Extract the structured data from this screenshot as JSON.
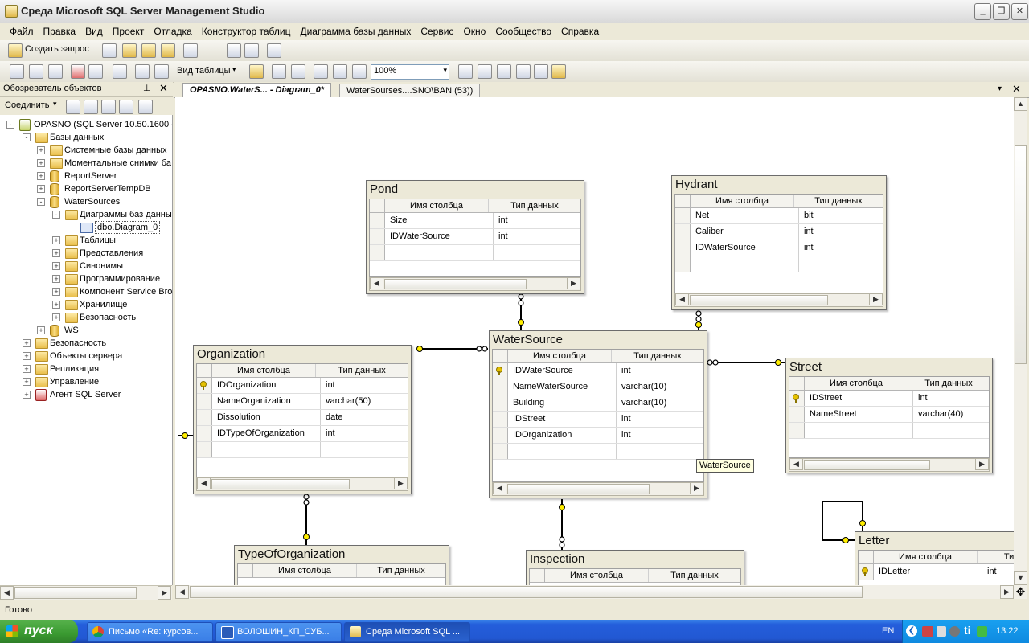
{
  "window": {
    "title": "Среда Microsoft SQL Server Management Studio"
  },
  "menu": [
    "Файл",
    "Правка",
    "Вид",
    "Проект",
    "Отладка",
    "Конструктор таблиц",
    "Диаграмма базы данных",
    "Сервис",
    "Окно",
    "Сообщество",
    "Справка"
  ],
  "toolbar1": {
    "new_query": "Создать запрос"
  },
  "toolbar2": {
    "view_table": "Вид таблицы",
    "zoom": "100%"
  },
  "object_explorer": {
    "title": "Обозреватель объектов",
    "connect": "Соединить",
    "tree": [
      {
        "label": "OPASNO (SQL Server 10.50.1600 -",
        "level": 0,
        "icon": "server",
        "exp": "-"
      },
      {
        "label": "Базы данных",
        "level": 1,
        "icon": "folder",
        "exp": "-"
      },
      {
        "label": "Системные базы данных",
        "level": 2,
        "icon": "folder",
        "exp": "+"
      },
      {
        "label": "Моментальные снимки ба",
        "level": 2,
        "icon": "folder",
        "exp": "+"
      },
      {
        "label": "ReportServer",
        "level": 2,
        "icon": "db",
        "exp": "+"
      },
      {
        "label": "ReportServerTempDB",
        "level": 2,
        "icon": "db",
        "exp": "+"
      },
      {
        "label": "WaterSources",
        "level": 2,
        "icon": "db",
        "exp": "-"
      },
      {
        "label": "Диаграммы баз данны",
        "level": 3,
        "icon": "folder",
        "exp": "-"
      },
      {
        "label": "dbo.Diagram_0",
        "level": 4,
        "icon": "diagram",
        "exp": ""
      },
      {
        "label": "Таблицы",
        "level": 3,
        "icon": "folder",
        "exp": "+"
      },
      {
        "label": "Представления",
        "level": 3,
        "icon": "folder",
        "exp": "+"
      },
      {
        "label": "Синонимы",
        "level": 3,
        "icon": "folder",
        "exp": "+"
      },
      {
        "label": "Программирование",
        "level": 3,
        "icon": "folder",
        "exp": "+"
      },
      {
        "label": "Компонент Service Bro",
        "level": 3,
        "icon": "folder",
        "exp": "+"
      },
      {
        "label": "Хранилище",
        "level": 3,
        "icon": "folder",
        "exp": "+"
      },
      {
        "label": "Безопасность",
        "level": 3,
        "icon": "folder",
        "exp": "+"
      },
      {
        "label": "WS",
        "level": 2,
        "icon": "db",
        "exp": "+"
      },
      {
        "label": "Безопасность",
        "level": 1,
        "icon": "folder",
        "exp": "+"
      },
      {
        "label": "Объекты сервера",
        "level": 1,
        "icon": "folder",
        "exp": "+"
      },
      {
        "label": "Репликация",
        "level": 1,
        "icon": "folder",
        "exp": "+"
      },
      {
        "label": "Управление",
        "level": 1,
        "icon": "folder",
        "exp": "+"
      },
      {
        "label": "Агент SQL Server",
        "level": 1,
        "icon": "agent",
        "exp": "+"
      }
    ]
  },
  "tabs": [
    {
      "label": "OPASNO.WaterS... - Diagram_0*"
    },
    {
      "label": "WaterSourses....SNO\\BAN (53))"
    }
  ],
  "grid_headers": {
    "col": "Имя столбца",
    "type": "Тип данных"
  },
  "tables": {
    "pond": {
      "name": "Pond",
      "rows": [
        [
          "Size",
          "int"
        ],
        [
          "IDWaterSource",
          "int"
        ]
      ]
    },
    "hydrant": {
      "name": "Hydrant",
      "rows": [
        [
          "Net",
          "bit"
        ],
        [
          "Caliber",
          "int"
        ],
        [
          "IDWaterSource",
          "int"
        ]
      ]
    },
    "organization": {
      "name": "Organization",
      "rows": [
        [
          "IDOrganization",
          "int"
        ],
        [
          "NameOrganization",
          "varchar(50)"
        ],
        [
          "Dissolution",
          "date"
        ],
        [
          "IDTypeOfOrganization",
          "int"
        ]
      ]
    },
    "watersource": {
      "name": "WaterSource",
      "rows": [
        [
          "IDWaterSource",
          "int"
        ],
        [
          "NameWaterSource",
          "varchar(10)"
        ],
        [
          "Building",
          "varchar(10)"
        ],
        [
          "IDStreet",
          "int"
        ],
        [
          "IDOrganization",
          "int"
        ]
      ]
    },
    "street": {
      "name": "Street",
      "rows": [
        [
          "IDStreet",
          "int"
        ],
        [
          "NameStreet",
          "varchar(40)"
        ]
      ]
    },
    "typeoforganization": {
      "name": "TypeOfOrganization"
    },
    "inspection": {
      "name": "Inspection"
    },
    "letter": {
      "name": "Letter",
      "rows": [
        [
          "IDLetter",
          "int"
        ]
      ],
      "type_header": "Тип"
    }
  },
  "tooltip": "WaterSource",
  "status": "Готово",
  "taskbar": {
    "start": "пуск",
    "tasks": [
      "Письмо «Re: курсов...",
      "ВОЛОШИН_КП_СУБ...",
      "Среда Microsoft SQL ..."
    ],
    "lang": "EN",
    "clock": "13:22"
  }
}
